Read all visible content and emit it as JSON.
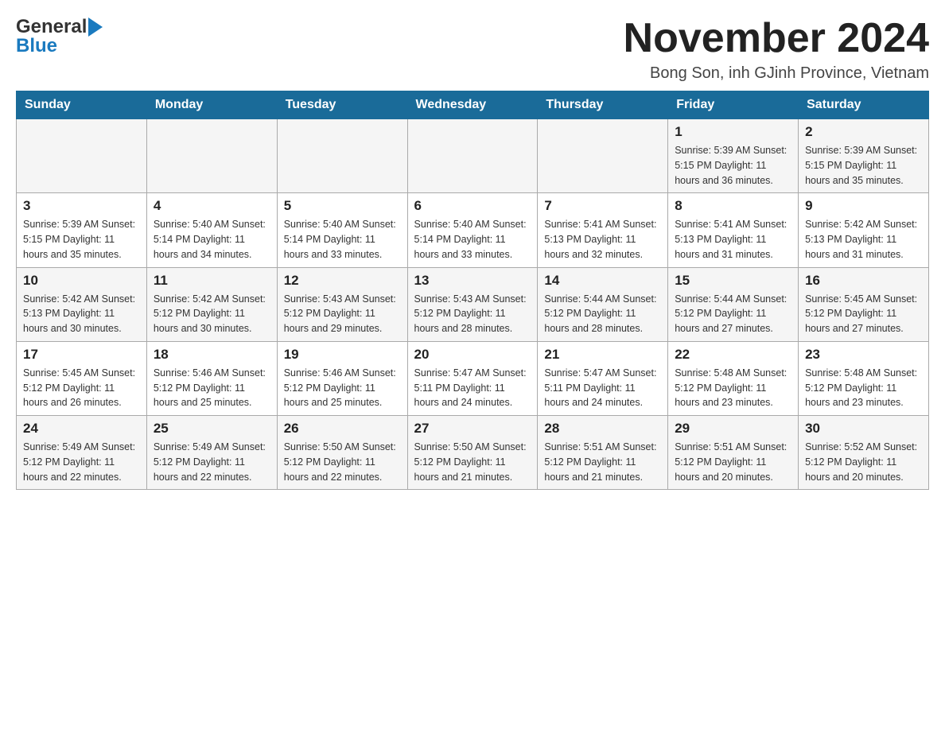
{
  "header": {
    "logo_general": "General",
    "logo_blue": "Blue",
    "month_title": "November 2024",
    "location": "Bong Son, inh GJinh Province, Vietnam"
  },
  "weekdays": [
    "Sunday",
    "Monday",
    "Tuesday",
    "Wednesday",
    "Thursday",
    "Friday",
    "Saturday"
  ],
  "weeks": [
    [
      {
        "day": "",
        "info": ""
      },
      {
        "day": "",
        "info": ""
      },
      {
        "day": "",
        "info": ""
      },
      {
        "day": "",
        "info": ""
      },
      {
        "day": "",
        "info": ""
      },
      {
        "day": "1",
        "info": "Sunrise: 5:39 AM\nSunset: 5:15 PM\nDaylight: 11 hours\nand 36 minutes."
      },
      {
        "day": "2",
        "info": "Sunrise: 5:39 AM\nSunset: 5:15 PM\nDaylight: 11 hours\nand 35 minutes."
      }
    ],
    [
      {
        "day": "3",
        "info": "Sunrise: 5:39 AM\nSunset: 5:15 PM\nDaylight: 11 hours\nand 35 minutes."
      },
      {
        "day": "4",
        "info": "Sunrise: 5:40 AM\nSunset: 5:14 PM\nDaylight: 11 hours\nand 34 minutes."
      },
      {
        "day": "5",
        "info": "Sunrise: 5:40 AM\nSunset: 5:14 PM\nDaylight: 11 hours\nand 33 minutes."
      },
      {
        "day": "6",
        "info": "Sunrise: 5:40 AM\nSunset: 5:14 PM\nDaylight: 11 hours\nand 33 minutes."
      },
      {
        "day": "7",
        "info": "Sunrise: 5:41 AM\nSunset: 5:13 PM\nDaylight: 11 hours\nand 32 minutes."
      },
      {
        "day": "8",
        "info": "Sunrise: 5:41 AM\nSunset: 5:13 PM\nDaylight: 11 hours\nand 31 minutes."
      },
      {
        "day": "9",
        "info": "Sunrise: 5:42 AM\nSunset: 5:13 PM\nDaylight: 11 hours\nand 31 minutes."
      }
    ],
    [
      {
        "day": "10",
        "info": "Sunrise: 5:42 AM\nSunset: 5:13 PM\nDaylight: 11 hours\nand 30 minutes."
      },
      {
        "day": "11",
        "info": "Sunrise: 5:42 AM\nSunset: 5:12 PM\nDaylight: 11 hours\nand 30 minutes."
      },
      {
        "day": "12",
        "info": "Sunrise: 5:43 AM\nSunset: 5:12 PM\nDaylight: 11 hours\nand 29 minutes."
      },
      {
        "day": "13",
        "info": "Sunrise: 5:43 AM\nSunset: 5:12 PM\nDaylight: 11 hours\nand 28 minutes."
      },
      {
        "day": "14",
        "info": "Sunrise: 5:44 AM\nSunset: 5:12 PM\nDaylight: 11 hours\nand 28 minutes."
      },
      {
        "day": "15",
        "info": "Sunrise: 5:44 AM\nSunset: 5:12 PM\nDaylight: 11 hours\nand 27 minutes."
      },
      {
        "day": "16",
        "info": "Sunrise: 5:45 AM\nSunset: 5:12 PM\nDaylight: 11 hours\nand 27 minutes."
      }
    ],
    [
      {
        "day": "17",
        "info": "Sunrise: 5:45 AM\nSunset: 5:12 PM\nDaylight: 11 hours\nand 26 minutes."
      },
      {
        "day": "18",
        "info": "Sunrise: 5:46 AM\nSunset: 5:12 PM\nDaylight: 11 hours\nand 25 minutes."
      },
      {
        "day": "19",
        "info": "Sunrise: 5:46 AM\nSunset: 5:12 PM\nDaylight: 11 hours\nand 25 minutes."
      },
      {
        "day": "20",
        "info": "Sunrise: 5:47 AM\nSunset: 5:11 PM\nDaylight: 11 hours\nand 24 minutes."
      },
      {
        "day": "21",
        "info": "Sunrise: 5:47 AM\nSunset: 5:11 PM\nDaylight: 11 hours\nand 24 minutes."
      },
      {
        "day": "22",
        "info": "Sunrise: 5:48 AM\nSunset: 5:12 PM\nDaylight: 11 hours\nand 23 minutes."
      },
      {
        "day": "23",
        "info": "Sunrise: 5:48 AM\nSunset: 5:12 PM\nDaylight: 11 hours\nand 23 minutes."
      }
    ],
    [
      {
        "day": "24",
        "info": "Sunrise: 5:49 AM\nSunset: 5:12 PM\nDaylight: 11 hours\nand 22 minutes."
      },
      {
        "day": "25",
        "info": "Sunrise: 5:49 AM\nSunset: 5:12 PM\nDaylight: 11 hours\nand 22 minutes."
      },
      {
        "day": "26",
        "info": "Sunrise: 5:50 AM\nSunset: 5:12 PM\nDaylight: 11 hours\nand 22 minutes."
      },
      {
        "day": "27",
        "info": "Sunrise: 5:50 AM\nSunset: 5:12 PM\nDaylight: 11 hours\nand 21 minutes."
      },
      {
        "day": "28",
        "info": "Sunrise: 5:51 AM\nSunset: 5:12 PM\nDaylight: 11 hours\nand 21 minutes."
      },
      {
        "day": "29",
        "info": "Sunrise: 5:51 AM\nSunset: 5:12 PM\nDaylight: 11 hours\nand 20 minutes."
      },
      {
        "day": "30",
        "info": "Sunrise: 5:52 AM\nSunset: 5:12 PM\nDaylight: 11 hours\nand 20 minutes."
      }
    ]
  ]
}
